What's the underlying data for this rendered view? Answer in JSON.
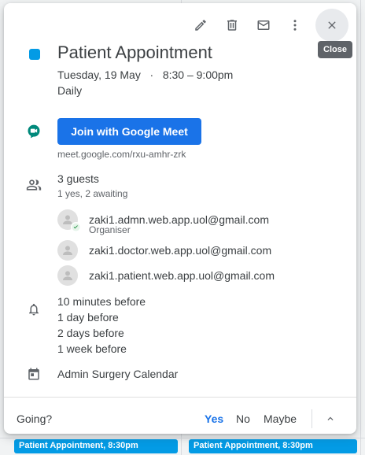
{
  "toolbar": {
    "edit_icon": "pencil-icon",
    "delete_icon": "trash-icon",
    "email_icon": "mail-icon",
    "more_icon": "more-vert-icon",
    "close_icon": "close-icon",
    "close_tooltip": "Close"
  },
  "event": {
    "color": "#039be5",
    "title": "Patient Appointment",
    "datetime": "Tuesday, 19 May   ·   8:30 – 9:00pm",
    "recurrence": "Daily"
  },
  "meet": {
    "button_label": "Join with Google Meet",
    "link": "meet.google.com/rxu-amhr-zrk"
  },
  "guests": {
    "title": "3 guests",
    "summary": "1 yes, 2 awaiting",
    "list": [
      {
        "email": "zaki1.admn.web.app.uol@gmail.com",
        "role": "Organiser"
      },
      {
        "email": "zaki1.doctor.web.app.uol@gmail.com"
      },
      {
        "email": "zaki1.patient.web.app.uol@gmail.com"
      }
    ]
  },
  "reminders": [
    "10 minutes before",
    "1 day before",
    "2 days before",
    "1 week before"
  ],
  "calendar": {
    "name": "Admin Surgery Calendar"
  },
  "rsvp": {
    "question": "Going?",
    "yes": "Yes",
    "no": "No",
    "maybe": "Maybe",
    "selected": "yes"
  },
  "background_events": [
    {
      "label": "Patient Appointment, 8:30pm"
    },
    {
      "label": "Patient Appointment, 8:30pm"
    }
  ],
  "colors": {
    "accent": "#1a73e8",
    "event": "#039be5"
  }
}
